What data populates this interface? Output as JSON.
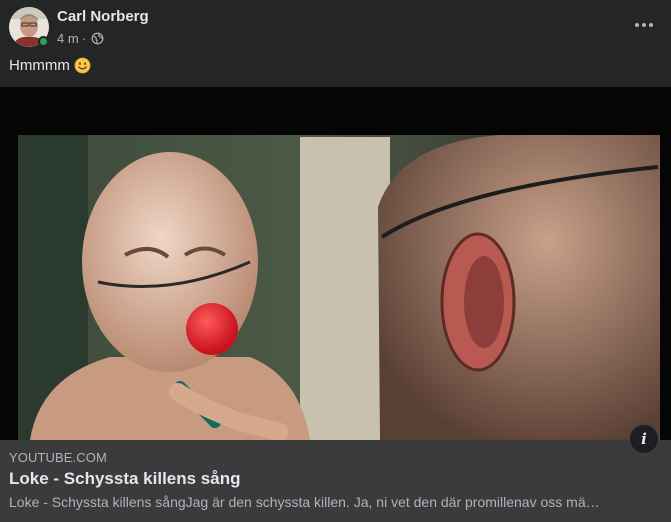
{
  "post": {
    "author": "Carl Norberg",
    "time": "4 m",
    "separator": "·",
    "privacy_icon": "globe-icon",
    "text": "Hmmmm",
    "emoji": "slightly-smiling-face",
    "more_icon": "more-horizontal-icon"
  },
  "media": {
    "description_icon": "video-thumbnail"
  },
  "link_preview": {
    "domain": "YOUTUBE.COM",
    "title": "Loke - Schyssta killens sång",
    "description": "Loke - Schyssta killens sångJag är den schyssta killen. Ja, ni vet den där promillenav oss mä…",
    "info_icon": "info-icon"
  },
  "colors": {
    "background": "#242526",
    "preview_background": "#3a3b3c",
    "primary_text": "#e4e6eb",
    "secondary_text": "#b0b3b8",
    "online": "#31a24c"
  }
}
